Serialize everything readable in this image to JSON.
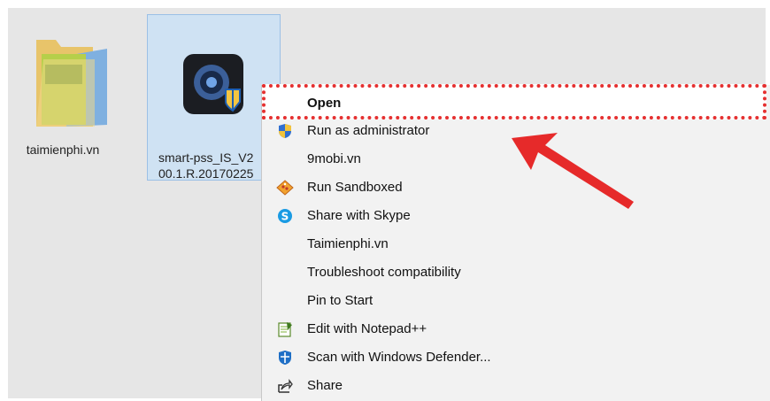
{
  "desktop": {
    "files": [
      {
        "label": "taimienphi.vn",
        "icon": "folder-icon"
      },
      {
        "label": "smart-pss_IS_V2",
        "label_line2": "00.1.R.20170225",
        "icon": "smartpss-app-icon"
      }
    ]
  },
  "context_menu": {
    "items": [
      {
        "label": "Open",
        "icon": "",
        "bold": true
      },
      {
        "label": "Run as administrator",
        "icon": "uac-shield-icon"
      },
      {
        "label": "9mobi.vn",
        "icon": ""
      },
      {
        "label": "Run Sandboxed",
        "icon": "sandbox-icon"
      },
      {
        "label": "Share with Skype",
        "icon": "skype-icon"
      },
      {
        "label": "Taimienphi.vn",
        "icon": ""
      },
      {
        "label": "Troubleshoot compatibility",
        "icon": ""
      },
      {
        "label": "Pin to Start",
        "icon": ""
      },
      {
        "label": "Edit with Notepad++",
        "icon": "notepadpp-icon"
      },
      {
        "label": "Scan with Windows Defender...",
        "icon": "windows-defender-icon"
      },
      {
        "label": "Share",
        "icon": "share-icon"
      }
    ]
  },
  "colors": {
    "highlight": "#e53030",
    "arrow": "#e62a2a",
    "selection": "#cfe2f3"
  }
}
